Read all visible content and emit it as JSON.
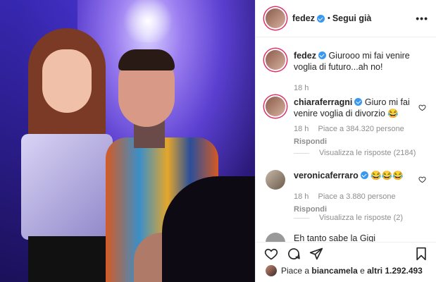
{
  "header": {
    "username": "fedez",
    "separator": "•",
    "follow_label": "Segui già",
    "more_label": "•••"
  },
  "caption": {
    "username": "fedez",
    "text": "Giurooo mi fai venire voglia di futuro...ah no!",
    "time": "18 h"
  },
  "comments": [
    {
      "username": "chiaraferragni",
      "text": "Giuro mi fai venire voglia di divorzio",
      "emoji": "😂",
      "time": "18 h",
      "likes": "Piace a 384.320 persone",
      "reply": "Rispondi",
      "view_replies": "Visualizza le risposte (2184)"
    },
    {
      "username": "veronicaferraro",
      "text": "",
      "emoji": "😂😂😂",
      "time": "18 h",
      "likes": "Piace a 3.880 persone",
      "reply": "Rispondi",
      "view_replies": "Visualizza le risposte (2)"
    },
    {
      "username": "",
      "text": "Eh tanto sabe la Gigi"
    }
  ],
  "actions": {
    "like_icon": "heart-icon",
    "comment_icon": "comment-icon",
    "share_icon": "share-icon",
    "save_icon": "bookmark-icon"
  },
  "likes_summary": {
    "prefix": "Piace a",
    "user": "biancamela",
    "middle": "e",
    "others": "altri 1.292.493"
  },
  "colors": {
    "verified": "#3897f0",
    "text": "#262626",
    "muted": "#8e8e8e"
  }
}
